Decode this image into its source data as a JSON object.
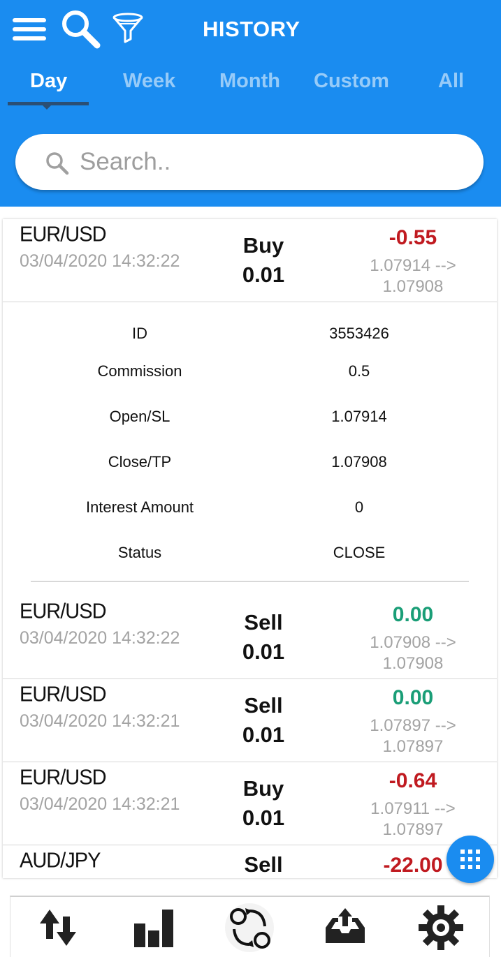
{
  "header": {
    "title": "HISTORY",
    "icons": {
      "menu": "menu-icon",
      "search": "search-icon",
      "filter": "filter-icon"
    }
  },
  "tabs": [
    {
      "label": "Day",
      "active": true
    },
    {
      "label": "Week",
      "active": false
    },
    {
      "label": "Month",
      "active": false
    },
    {
      "label": "Custom",
      "active": false
    },
    {
      "label": "All",
      "active": false
    }
  ],
  "search": {
    "placeholder": "Search..",
    "value": ""
  },
  "trades": [
    {
      "symbol": "EUR/USD",
      "datetime": "03/04/2020 14:32:22",
      "side": "Buy",
      "lot": "0.01",
      "profit": "-0.55",
      "profit_sign": "neg",
      "price_line1": "1.07914 -->",
      "price_line2": "1.07908",
      "expanded": true
    },
    {
      "symbol": "EUR/USD",
      "datetime": "03/04/2020 14:32:22",
      "side": "Sell",
      "lot": "0.01",
      "profit": "0.00",
      "profit_sign": "pos",
      "price_line1": "1.07908 -->",
      "price_line2": "1.07908"
    },
    {
      "symbol": "EUR/USD",
      "datetime": "03/04/2020 14:32:21",
      "side": "Sell",
      "lot": "0.01",
      "profit": "0.00",
      "profit_sign": "pos",
      "price_line1": "1.07897 -->",
      "price_line2": "1.07897"
    },
    {
      "symbol": "EUR/USD",
      "datetime": "03/04/2020 14:32:21",
      "side": "Buy",
      "lot": "0.01",
      "profit": "-0.64",
      "profit_sign": "neg",
      "price_line1": "1.07911 -->",
      "price_line2": "1.07897"
    },
    {
      "symbol": "AUD/JPY",
      "datetime": "",
      "side": "Sell",
      "lot": "",
      "profit": "-22.00",
      "profit_sign": "neg",
      "price_line1": "",
      "price_line2": ""
    }
  ],
  "details": [
    {
      "label": "ID",
      "value": "3553426"
    },
    {
      "label": "Commission",
      "value": "0.5"
    },
    {
      "label": "Open/SL",
      "value": "1.07914"
    },
    {
      "label": "Close/TP",
      "value": "1.07908"
    },
    {
      "label": "Interest Amount",
      "value": "0"
    },
    {
      "label": "Status",
      "value": "CLOSE"
    }
  ],
  "fab": {
    "icon": "grid-icon"
  },
  "bottom_nav": [
    {
      "icon": "trade-arrows-icon"
    },
    {
      "icon": "bar-chart-icon"
    },
    {
      "icon": "history-cycle-icon",
      "active": true
    },
    {
      "icon": "inbox-upload-icon"
    },
    {
      "icon": "gear-icon"
    }
  ],
  "colors": {
    "primary": "#1a8cf0",
    "negative": "#c01a20",
    "positive": "#1a9e77",
    "muted": "#a3a3a3"
  }
}
